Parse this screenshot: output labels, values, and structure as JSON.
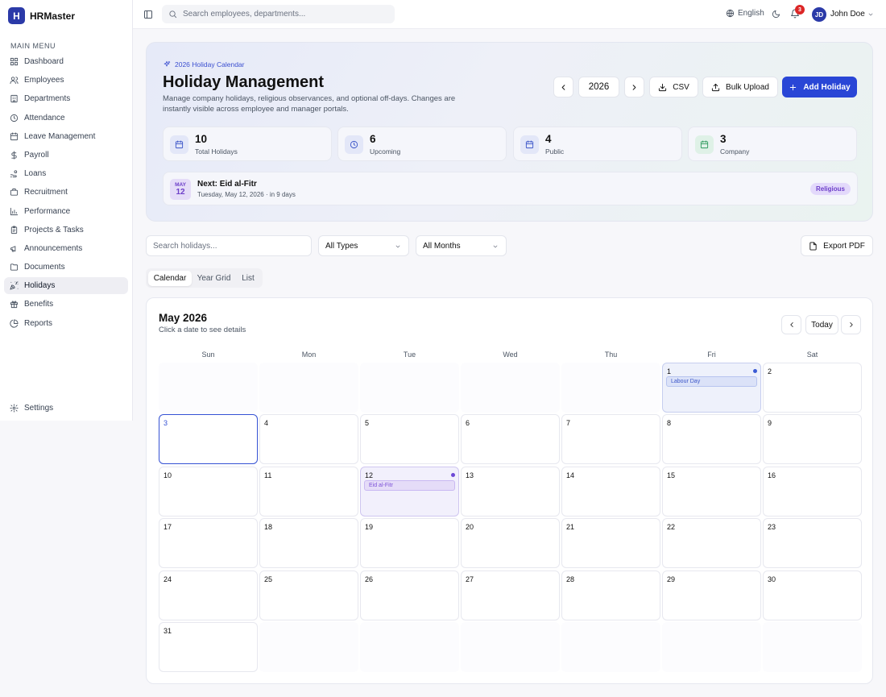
{
  "app": {
    "logo_letter": "H",
    "name": "HRMaster"
  },
  "sidebar": {
    "section_title": "MAIN MENU",
    "items": [
      {
        "label": "Dashboard",
        "icon": "dashboard-icon"
      },
      {
        "label": "Employees",
        "icon": "users-icon"
      },
      {
        "label": "Departments",
        "icon": "building-icon"
      },
      {
        "label": "Attendance",
        "icon": "clock-icon"
      },
      {
        "label": "Leave Management",
        "icon": "calendar-icon"
      },
      {
        "label": "Payroll",
        "icon": "dollar-icon"
      },
      {
        "label": "Loans",
        "icon": "hand-coins-icon"
      },
      {
        "label": "Recruitment",
        "icon": "briefcase-icon"
      },
      {
        "label": "Performance",
        "icon": "bar-chart-icon"
      },
      {
        "label": "Projects & Tasks",
        "icon": "clipboard-icon"
      },
      {
        "label": "Announcements",
        "icon": "megaphone-icon"
      },
      {
        "label": "Documents",
        "icon": "folder-icon"
      },
      {
        "label": "Holidays",
        "icon": "party-popper-icon",
        "active": true
      },
      {
        "label": "Benefits",
        "icon": "gift-icon"
      },
      {
        "label": "Reports",
        "icon": "pie-chart-icon"
      }
    ],
    "settings_label": "Settings"
  },
  "topbar": {
    "search_placeholder": "Search employees, departments...",
    "language": "English",
    "notification_count": "3",
    "user_initials": "JD",
    "user_name": "John Doe"
  },
  "hero": {
    "tag": "2026 Holiday Calendar",
    "title": "Holiday Management",
    "description": "Manage company holidays, religious observances, and optional off-days. Changes are instantly visible across employee and manager portals.",
    "year": "2026",
    "csv_label": "CSV",
    "bulk_upload_label": "Bulk Upload",
    "add_label": "Add Holiday",
    "stats": [
      {
        "value": "10",
        "label": "Total Holidays",
        "color": "#e3e7f8",
        "icon_color": "#3b55c8"
      },
      {
        "value": "6",
        "label": "Upcoming",
        "color": "#e3e7f8",
        "icon_color": "#3b55c8"
      },
      {
        "value": "4",
        "label": "Public",
        "color": "#e3e7f8",
        "icon_color": "#3b55c8"
      },
      {
        "value": "3",
        "label": "Company",
        "color": "#dff1e7",
        "icon_color": "#2f9a5e"
      }
    ],
    "next": {
      "month": "MAY",
      "day": "12",
      "title": "Next: Eid al-Fitr",
      "subtitle": "Tuesday, May 12, 2026 · in 9 days",
      "badge": "Religious"
    }
  },
  "filters": {
    "search_placeholder": "Search holidays...",
    "type": "All Types",
    "month": "All Months",
    "export_label": "Export PDF"
  },
  "view_tabs": [
    {
      "label": "Calendar",
      "active": true
    },
    {
      "label": "Year Grid"
    },
    {
      "label": "List"
    }
  ],
  "calendar": {
    "title": "May 2026",
    "subtitle": "Click a date to see details",
    "today_label": "Today",
    "weekdays": [
      "Sun",
      "Mon",
      "Tue",
      "Wed",
      "Thu",
      "Fri",
      "Sat"
    ],
    "first_weekday": 5,
    "days_in_month": 31,
    "today": 3,
    "events": [
      {
        "day": 1,
        "label": "Labour Day",
        "color": "blue"
      },
      {
        "day": 12,
        "label": "Eid al-Fitr",
        "color": "purple"
      }
    ]
  }
}
